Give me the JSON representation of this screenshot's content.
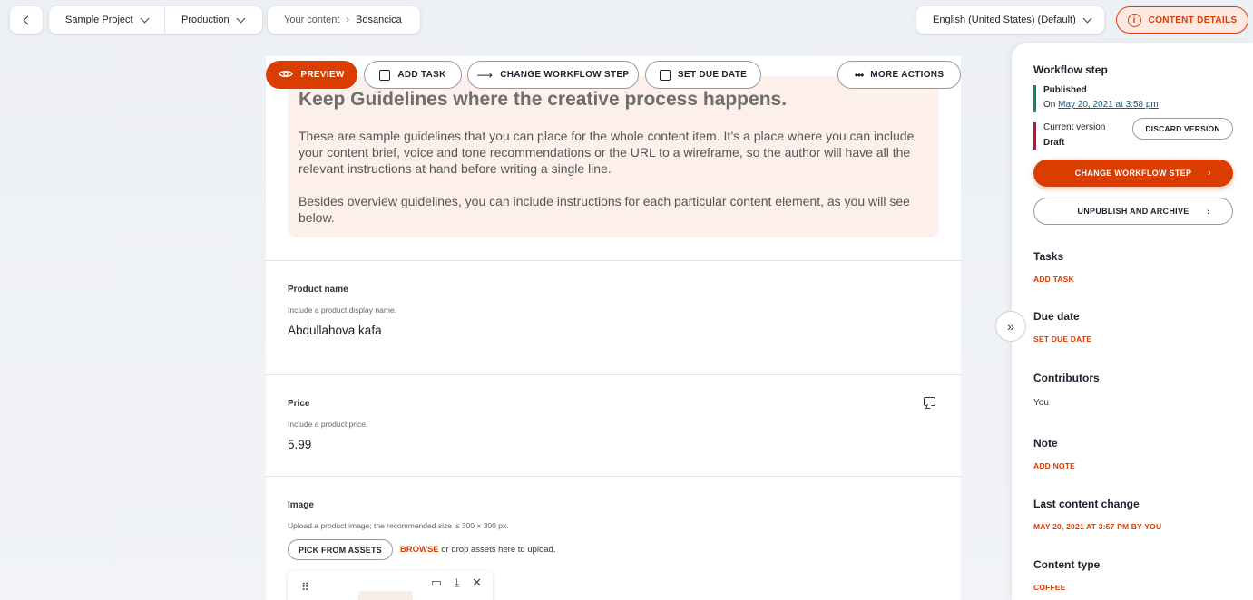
{
  "topbar": {
    "back_icon": "chevron-left",
    "project": "Sample Project",
    "environment": "Production",
    "path_root": "Your content",
    "path_sep": "›",
    "path_item": "Bosancica",
    "language": "English (United States) (Default)",
    "details_label": "CONTENT DETAILS"
  },
  "actions": {
    "preview": "PREVIEW",
    "add_task": "ADD TASK",
    "change_workflow": "CHANGE WORKFLOW STEP",
    "set_due_date": "SET DUE DATE",
    "more_actions": "MORE ACTIONS"
  },
  "guidelines": {
    "title": "Keep Guidelines where the creative process happens.",
    "p1": "These are sample guidelines that you can place for the whole content item. It’s a place where you can include your content brief, voice and tone recommendations or the URL to a wireframe, so the author will have all the relevant instructions at hand before writing a single line.",
    "p2": "Besides overview guidelines, you can include instructions for each particular content element, as you will see below."
  },
  "fields": {
    "product_name": {
      "label": "Product name",
      "hint": "Include a product display name.",
      "value": "Abdullahova kafa"
    },
    "price": {
      "label": "Price",
      "hint": "Include a product price.",
      "value": "5.99"
    },
    "image": {
      "label": "Image",
      "hint": "Upload a product image; the recommended size is 300 × 300 px.",
      "pick_label": "PICK FROM ASSETS",
      "browse_label": "BROWSE",
      "browse_rest": "or drop assets here to upload."
    }
  },
  "side": {
    "workflow_heading": "Workflow step",
    "published_label": "Published",
    "published_prefix": "On",
    "published_date": "May 20, 2021 at 3:58 pm",
    "current_version_label": "Current version",
    "current_version_value": "Draft",
    "discard_label": "DISCARD VERSION",
    "change_workflow_label": "CHANGE WORKFLOW STEP",
    "unpublish_label": "UNPUBLISH AND ARCHIVE",
    "tasks_heading": "Tasks",
    "add_task_link": "ADD TASK",
    "due_heading": "Due date",
    "set_due_link": "SET DUE DATE",
    "contributors_heading": "Contributors",
    "contributors_value": "You",
    "note_heading": "Note",
    "add_note_link": "ADD NOTE",
    "last_change_heading": "Last content change",
    "last_change_value": "MAY 20, 2021 AT 3:57 PM BY YOU",
    "content_type_heading": "Content type",
    "content_type_value": "COFFEE"
  },
  "colors": {
    "accent": "#db3c00",
    "published": "#0f8a5f",
    "draft": "#c8102e",
    "guidelines_bg": "#fdf0ea"
  }
}
